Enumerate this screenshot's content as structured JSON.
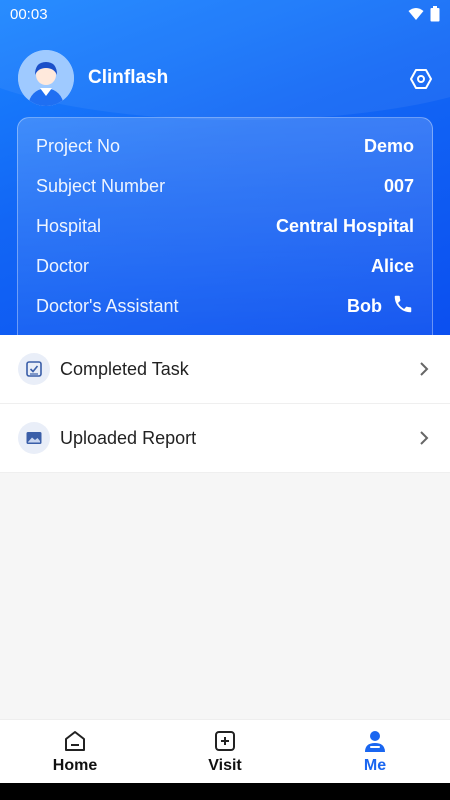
{
  "status_bar": {
    "time": "00:03"
  },
  "profile": {
    "name": "Clinflash"
  },
  "info": [
    {
      "label": "Project No",
      "value": "Demo"
    },
    {
      "label": "Subject Number",
      "value": "007"
    },
    {
      "label": "Hospital",
      "value": "Central Hospital"
    },
    {
      "label": "Doctor",
      "value": "Alice"
    },
    {
      "label": "Doctor's Assistant",
      "value": "Bob"
    }
  ],
  "menu": [
    {
      "label": "Completed Task",
      "icon": "task-icon"
    },
    {
      "label": "Uploaded Report",
      "icon": "image-report-icon"
    }
  ],
  "tabs": [
    {
      "label": "Home",
      "icon": "home-icon"
    },
    {
      "label": "Visit",
      "icon": "visit-add-icon"
    },
    {
      "label": "Me",
      "icon": "person-icon",
      "active": true
    }
  ],
  "colors": {
    "accent": "#1a66f0",
    "header_start": "#1b86ff",
    "header_end": "#0b4ff0"
  }
}
